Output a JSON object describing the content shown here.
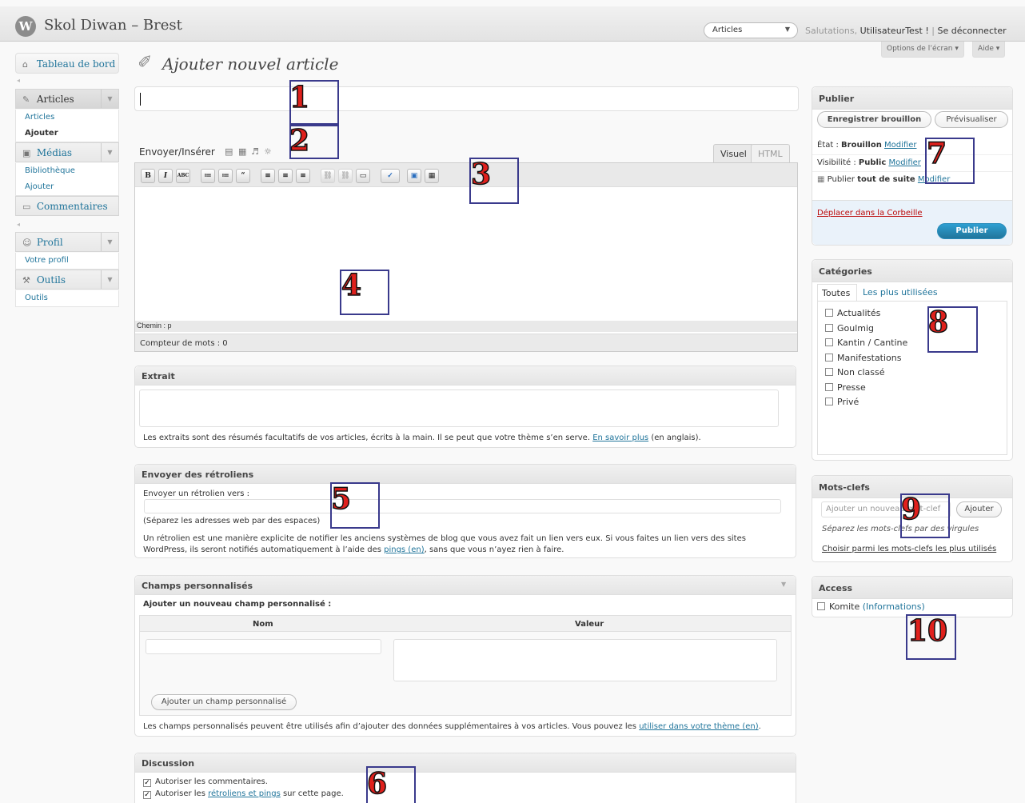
{
  "header": {
    "logo": "W",
    "site_title": "Skol Diwan – Brest",
    "favorites_value": "Articles",
    "greeting": "Salutations, ",
    "username": "UtilisateurTest !",
    "separator": " | ",
    "logout": "Se déconnecter",
    "screen_options": "Options de l’écran ▾",
    "help": "Aide ▾"
  },
  "menu": {
    "dashboard": "Tableau de bord",
    "posts": "Articles",
    "posts_sub": [
      "Articles",
      "Ajouter"
    ],
    "media": "Médias",
    "media_sub": [
      "Bibliothèque",
      "Ajouter"
    ],
    "comments": "Commentaires",
    "profile": "Profil",
    "profile_sub": [
      "Votre profil"
    ],
    "tools": "Outils",
    "tools_sub": [
      "Outils"
    ]
  },
  "page": {
    "title": "Ajouter nouvel article",
    "title_value": ""
  },
  "editor": {
    "upload_label": "Envoyer/Insérer",
    "tab_visual": "Visuel",
    "tab_html": "HTML",
    "toolbar": [
      "B",
      "I",
      "ABC",
      "≔",
      "≔",
      "“",
      "≡",
      "≡",
      "≡",
      "⛓",
      "⛓",
      "▭",
      "✓",
      "▣",
      "▦"
    ],
    "path": "Chemin : p",
    "word_count": "Compteur de mots : 0"
  },
  "excerpt": {
    "title": "Extrait",
    "help": "Les extraits sont des résumés facultatifs de vos articles, écrits à la main. Il se peut que votre thème s’en serve.",
    "link": "En savoir plus",
    "suffix": " (en anglais)."
  },
  "trackbacks": {
    "title": "Envoyer des rétroliens",
    "label": "Envoyer un rétrolien vers :",
    "hint": "(Séparez les adresses web par des espaces)",
    "desc1": "Un rétrolien est une manière explicite de notifier les anciens systèmes de blog que vous avez fait un lien vers eux. Si vous faites un lien vers des sites",
    "desc2_pre": "WordPress, ils seront notifiés automatiquement à l’aide des ",
    "desc2_link": "pings (en)",
    "desc2_post": ", sans que vous n’ayez rien à faire."
  },
  "custom_fields": {
    "title": "Champs personnalisés",
    "add_label": "Ajouter un nouveau champ personnalisé :",
    "col_name": "Nom",
    "col_value": "Valeur",
    "add_button": "Ajouter un champ personnalisé",
    "help_pre": "Les champs personnalisés peuvent être utilisés afin d’ajouter des données supplémentaires à vos articles. Vous pouvez les ",
    "help_link": "utiliser dans votre thème (en)",
    "help_post": "."
  },
  "discussion": {
    "title": "Discussion",
    "allow_comments": "Autoriser les commentaires.",
    "allow_pings_pre": "Autoriser les ",
    "allow_pings_link": "rétroliens et pings",
    "allow_pings_post": " sur cette page."
  },
  "publish": {
    "title": "Publier",
    "save_draft": "Enregistrer brouillon",
    "preview": "Prévisualiser",
    "status_label": "État : ",
    "status_value": "Brouillon",
    "visibility_label": "Visibilité : ",
    "visibility_value": "Public",
    "publish_label": "Publier ",
    "publish_value": "tout de suite",
    "edit": "Modifier",
    "trash": "Déplacer dans la Corbeille",
    "publish_button": "Publier"
  },
  "categories": {
    "title": "Catégories",
    "tab_all": "Toutes",
    "tab_popular": "Les plus utilisées",
    "items": [
      "Actualités",
      "Goulmig",
      "Kantin / Cantine",
      "Manifestations",
      "Non classé",
      "Presse",
      "Privé"
    ]
  },
  "tags": {
    "title": "Mots-clefs",
    "placeholder": "Ajouter un nouveau mot-clef",
    "add_button": "Ajouter",
    "hint": "Séparez les mots-clefs par des virgules",
    "choose_link": "Choisir parmi les mots-clefs les plus utilisés"
  },
  "access": {
    "title": "Access",
    "option": "Komite",
    "info": "(Informations)"
  },
  "annotations": [
    "1",
    "2",
    "3",
    "4",
    "5",
    "6",
    "7",
    "8",
    "9",
    "10"
  ],
  "colors": {
    "link": "#21759b",
    "annotation_box": "#3a3a8c",
    "annotation_number": "#e0201c",
    "trash": "#bc0b0b"
  }
}
